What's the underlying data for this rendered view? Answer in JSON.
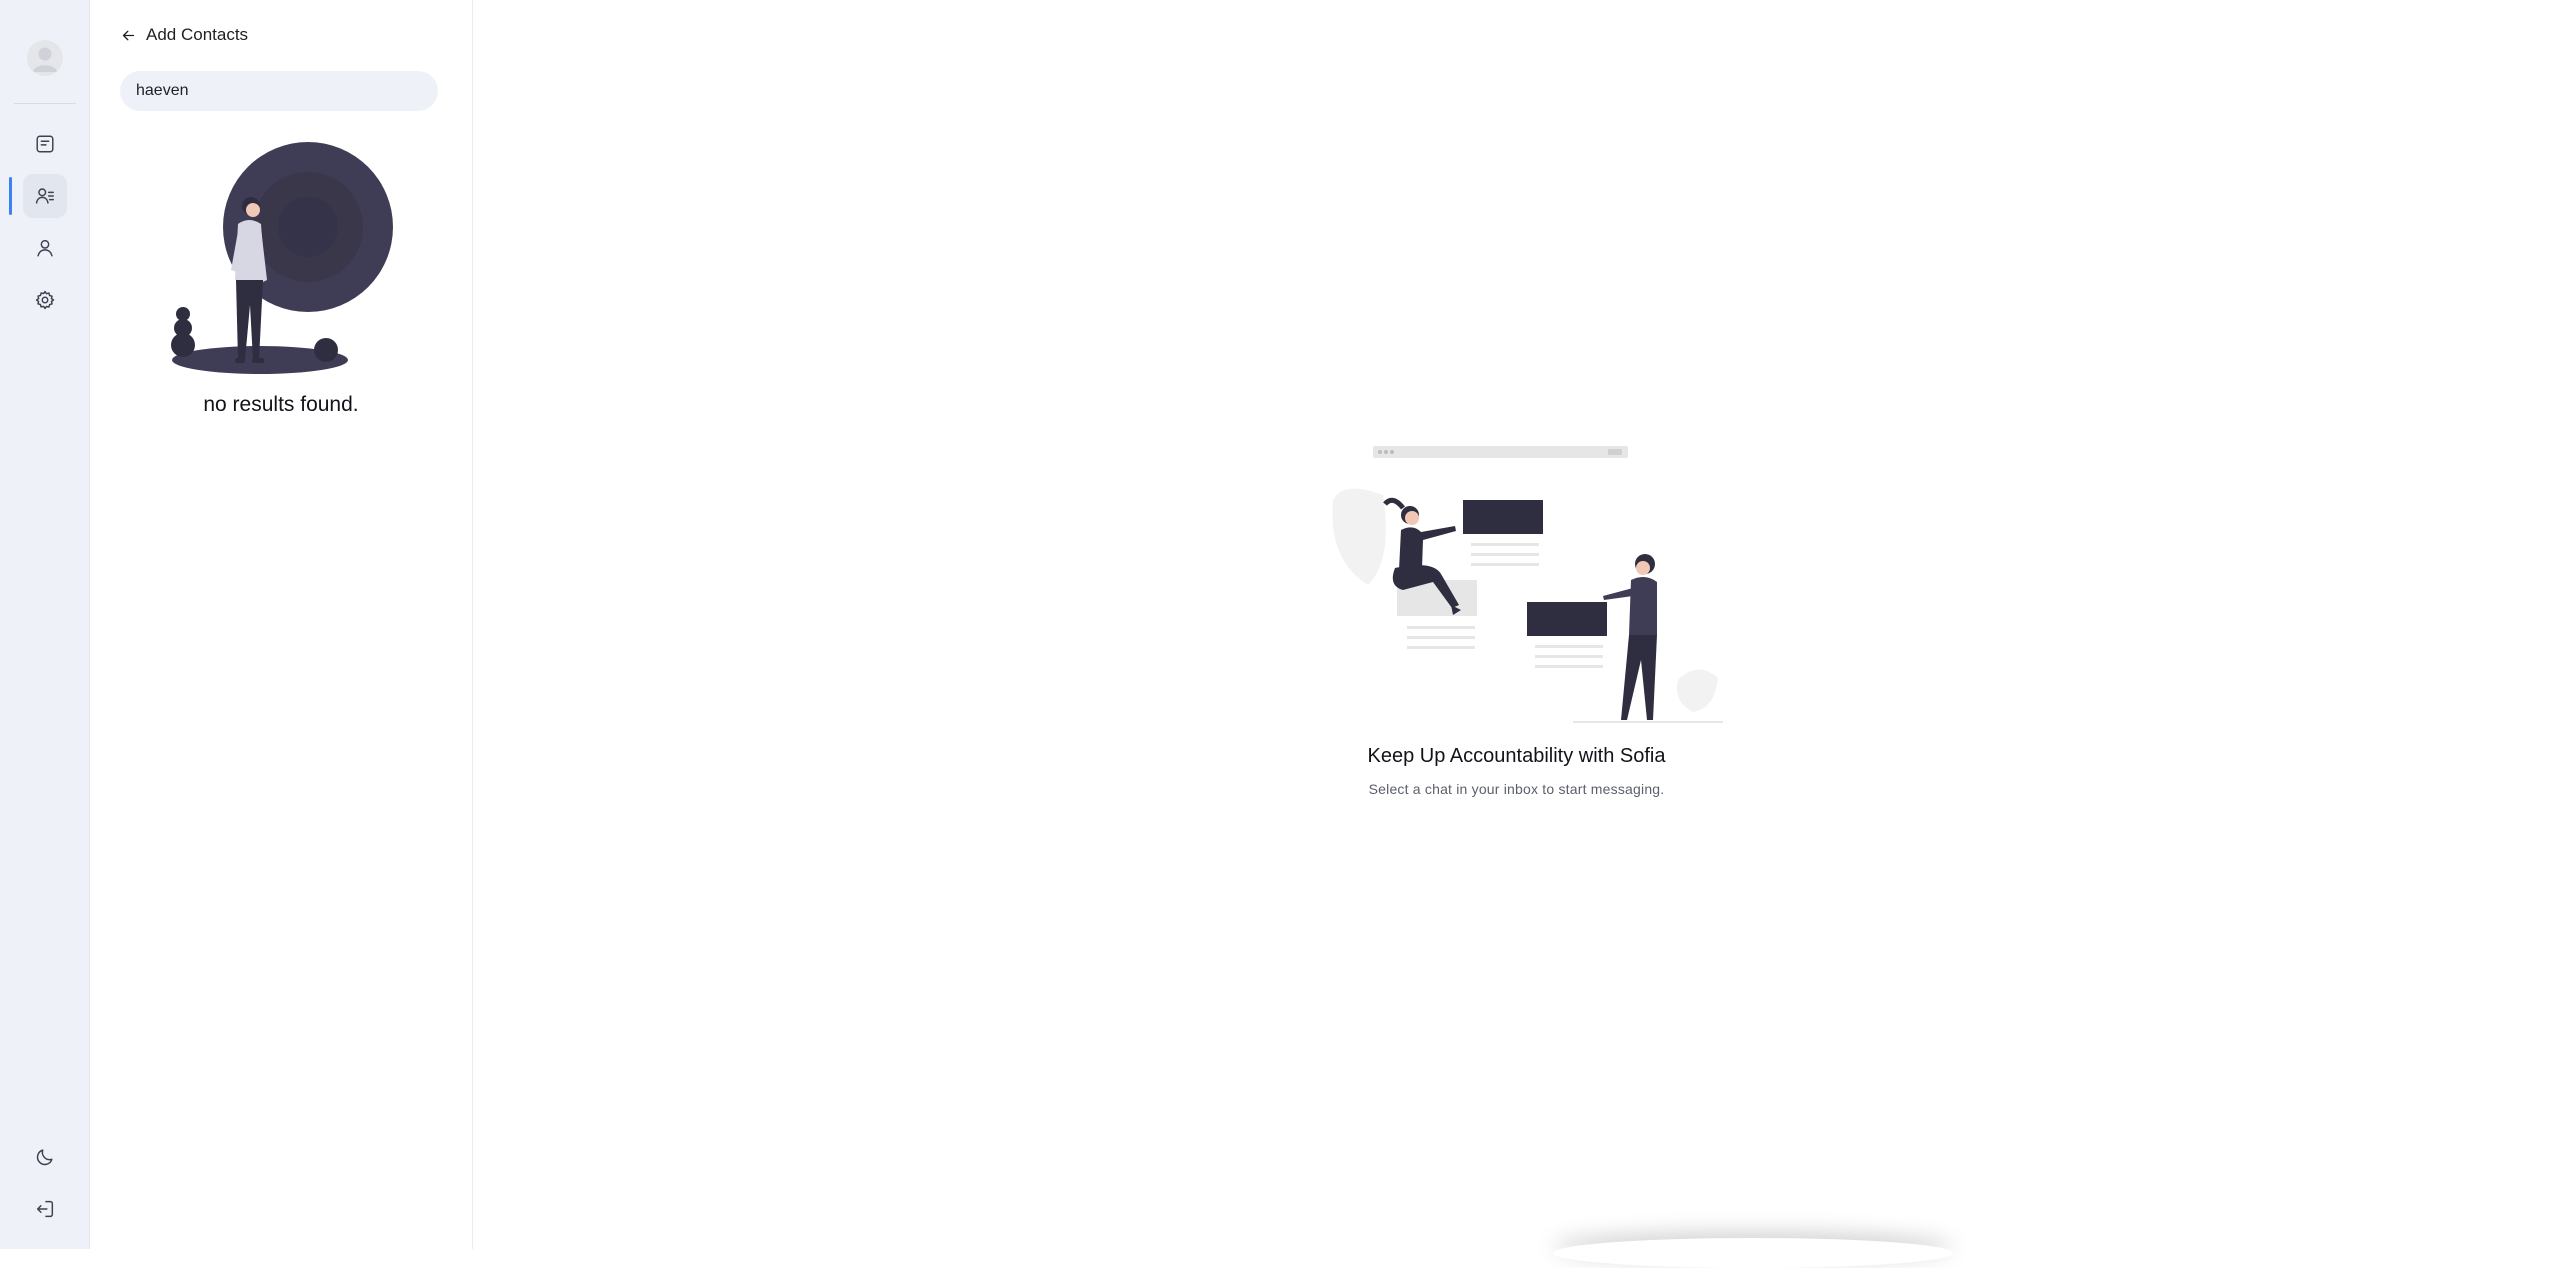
{
  "rail": {
    "items": [
      {
        "name": "chats-icon"
      },
      {
        "name": "contacts-icon",
        "active": true
      },
      {
        "name": "profile-icon"
      },
      {
        "name": "settings-icon"
      }
    ],
    "bottom": [
      {
        "name": "moon-icon"
      },
      {
        "name": "logout-icon"
      }
    ]
  },
  "contacts_panel": {
    "title": "Add Contacts",
    "search_value": "haeven",
    "empty_message": "no results found."
  },
  "main": {
    "title": "Keep Up Accountability with Sofia",
    "subtitle": "Select a chat in your inbox to start messaging."
  },
  "colors": {
    "accent": "#3b82f6",
    "rail_bg": "#eef1f7",
    "illustration_dark": "#3f3d56"
  }
}
